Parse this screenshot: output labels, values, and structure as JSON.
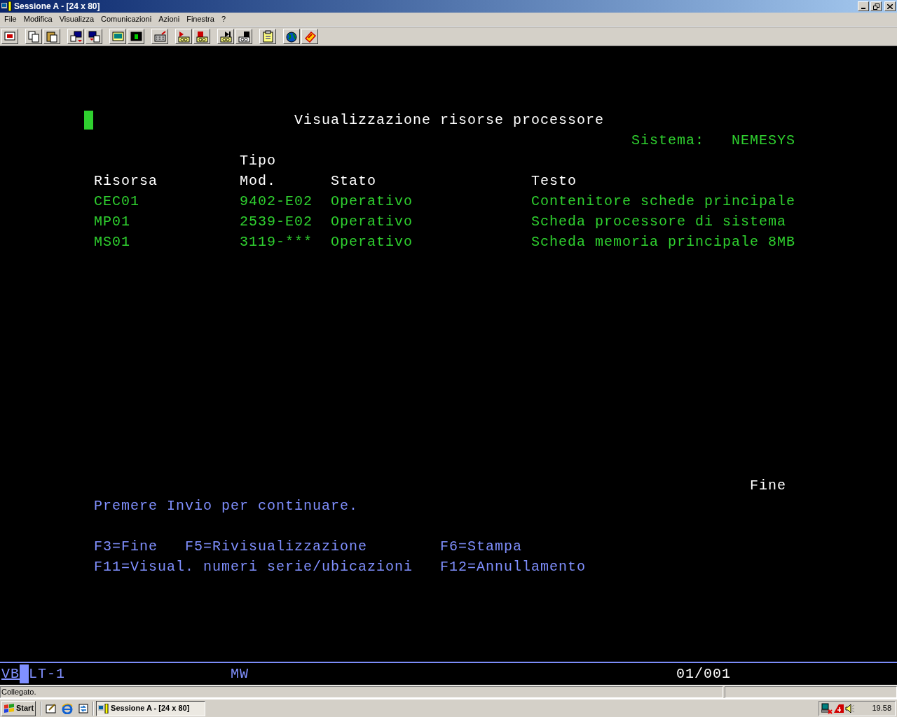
{
  "window": {
    "title": "Sessione A - [24 x 80]"
  },
  "menu": [
    "File",
    "Modifica",
    "Visualizza",
    "Comunicazioni",
    "Azioni",
    "Finestra",
    "?"
  ],
  "screen": {
    "title": "Visualizzazione risorse processore",
    "system_label": "Sistema:",
    "system_name": "NEMESYS",
    "columns": [
      {
        "lines": [
          "Risorsa"
        ]
      },
      {
        "lines": [
          "Tipo",
          "Mod."
        ]
      },
      {
        "lines": [
          "Stato"
        ]
      },
      {
        "lines": [
          "Testo"
        ]
      }
    ],
    "rows": [
      [
        "CEC01",
        "9402-E02",
        "Operativo",
        "Contenitore schede principale"
      ],
      [
        "MP01",
        "2539-E02",
        "Operativo",
        "Scheda processore di sistema"
      ],
      [
        "MS01",
        "3119-***",
        "Operativo",
        "Scheda memoria principale 8MB"
      ]
    ],
    "more": "Fine",
    "instruction": "Premere Invio per continuare.",
    "function_keys": [
      [
        "F3=Fine",
        "F5=Rivisualizzazione",
        "F6=Stampa"
      ],
      [
        "F11=Visual. numeri serie/ubicazioni",
        "F12=Annullamento"
      ]
    ]
  },
  "status_line": {
    "indicators": [
      "VB",
      "LT-1"
    ],
    "keyboard": "MW",
    "position": "01/001"
  },
  "status_bar": {
    "text": "Collegato."
  },
  "taskbar": {
    "start": "Start",
    "tasks": [
      {
        "label": "Sessione A - [24 x 80]",
        "selected": true
      }
    ],
    "clock": "19.58"
  }
}
